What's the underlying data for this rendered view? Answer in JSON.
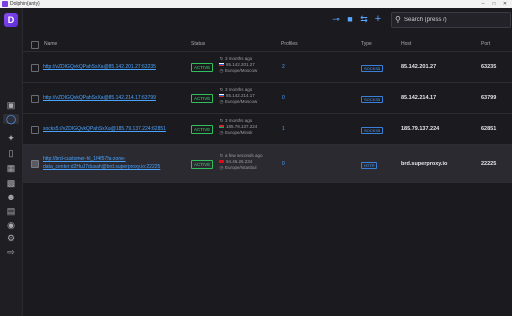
{
  "window": {
    "title": "Dolphin{anty}"
  },
  "toolbar": {
    "search_placeholder": "Search (press /)",
    "icons": [
      "share-icon",
      "trash-icon",
      "swap-icon",
      "plus-icon",
      "search-icon"
    ]
  },
  "table": {
    "columns": {
      "name": "Name",
      "status": "Status",
      "profiles": "Profiles",
      "type": "Type",
      "host": "Host",
      "port": "Port"
    },
    "rows": [
      {
        "name": "http://vZDIGQvkQPahSxXa@85.142.201.27:63235",
        "status": "ACTIVE",
        "checked_ago": "3 months ago",
        "ip": "85.142.201.27",
        "location": "Europe/Moscow",
        "profiles": "2",
        "type": "SOCKS5",
        "host": "85.142.201.27",
        "port": "63235"
      },
      {
        "name": "http://vZDIGQvkQPahSxXa@85.142.214.17:63799",
        "status": "ACTIVE",
        "checked_ago": "3 months ago",
        "ip": "85.142.214.17",
        "location": "Europe/Moscow",
        "profiles": "0",
        "type": "SOCKS5",
        "host": "85.142.214.17",
        "port": "63799"
      },
      {
        "name": "socks5://vZDIGQvkQPahSxXa@185.79.137.224:62851",
        "status": "ACTIVE",
        "checked_ago": "3 months ago",
        "ip": "185.79.137.224",
        "location": "Europe/Minsk",
        "profiles": "1",
        "type": "SOCKS5",
        "host": "185.79.137.224",
        "port": "62851"
      },
      {
        "name_line1": "http://brd-customer-hl_1f4f57fa-zone-",
        "name_line2": "data_center:d2HuJ7dusah@brd.superproxy.io:22225",
        "status": "ACTIVE",
        "checked_ago": "a few seconds ago",
        "ip": "94.46.26.234",
        "location": "Europe/Istanbul",
        "profiles": "0",
        "type": "HTTP",
        "host": "brd.superproxy.io",
        "port": "22225"
      }
    ]
  },
  "colors": {
    "accent": "#58a6ff",
    "active": "#3dd36b",
    "brand": "#7b3fe4"
  }
}
